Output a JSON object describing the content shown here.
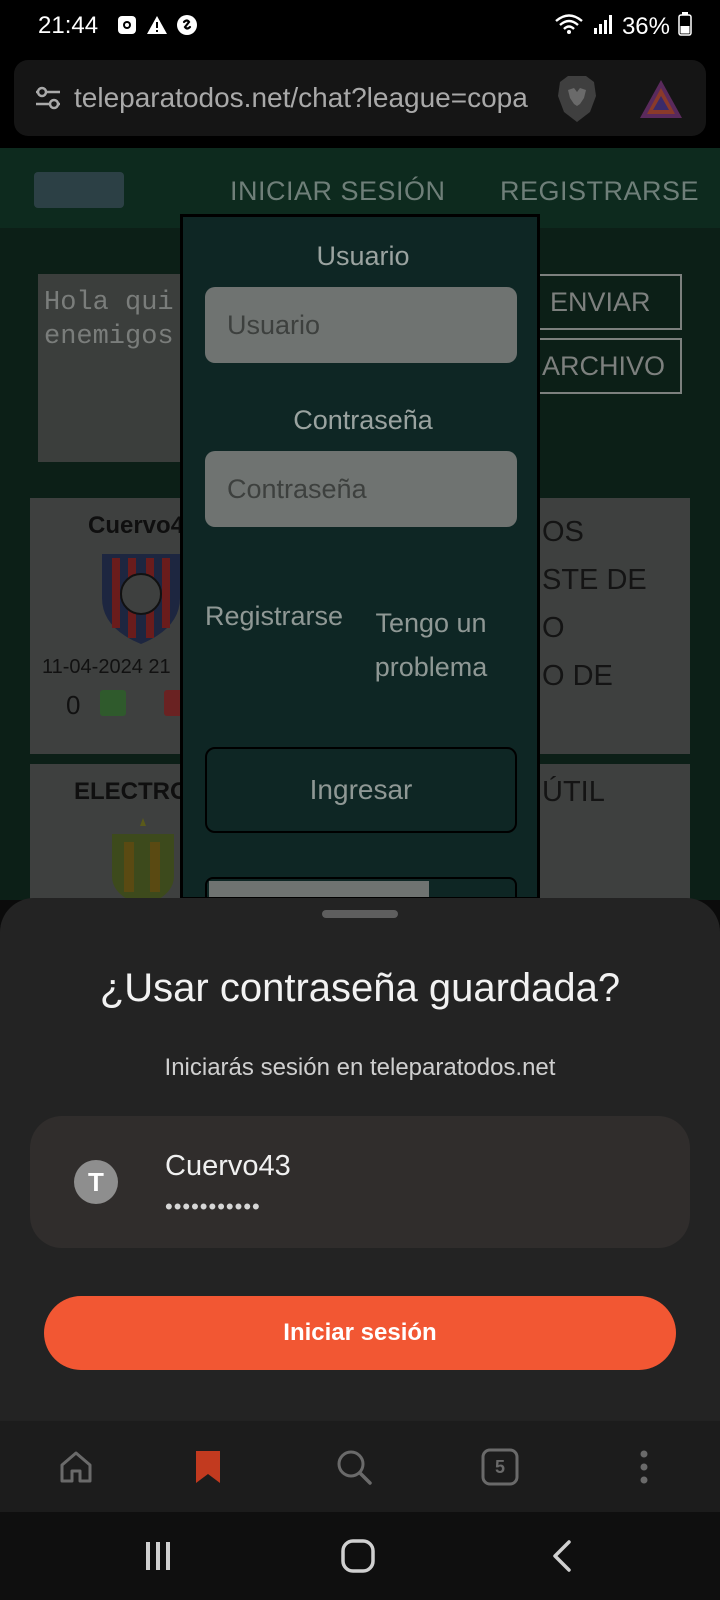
{
  "status_bar": {
    "time": "21:44",
    "battery": "36%"
  },
  "browser": {
    "url": "teleparatodos.net/chat?league=copa",
    "tab_count": "5"
  },
  "website": {
    "nav": {
      "login": "INICIAR SESIÓN",
      "register": "REGISTRARSE"
    },
    "chat_placeholder": "Hola qui\nenemigos",
    "buttons": {
      "send": "ENVIAR",
      "file": "ARCHIVO"
    },
    "posts": [
      {
        "author": "Cuervo4",
        "date": "11-04-2024 21",
        "likes": "0",
        "text": "OS\nSTE DE\nO\nO DE"
      },
      {
        "author": "ELECTRO",
        "text": "ÚTIL"
      }
    ]
  },
  "login_modal": {
    "user_label": "Usuario",
    "user_placeholder": "Usuario",
    "password_label": "Contraseña",
    "password_placeholder": "Contraseña",
    "register_link": "Registrarse",
    "problem_link": "Tengo un problema",
    "submit": "Ingresar"
  },
  "password_sheet": {
    "title": "¿Usar contraseña guardada?",
    "subtitle": "Iniciarás sesión en teleparatodos.net",
    "account": {
      "avatar_letter": "T",
      "username": "Cuervo43",
      "password_mask": "•••••••••••"
    },
    "signin_button": "Iniciar sesión"
  },
  "toolbar_icons": [
    "home-icon",
    "bookmark-icon",
    "search-icon",
    "tabs-icon",
    "more-icon"
  ],
  "colors": {
    "accent": "#f25733",
    "bookmark": "#c23a1f",
    "sheet_bg": "#232323"
  }
}
